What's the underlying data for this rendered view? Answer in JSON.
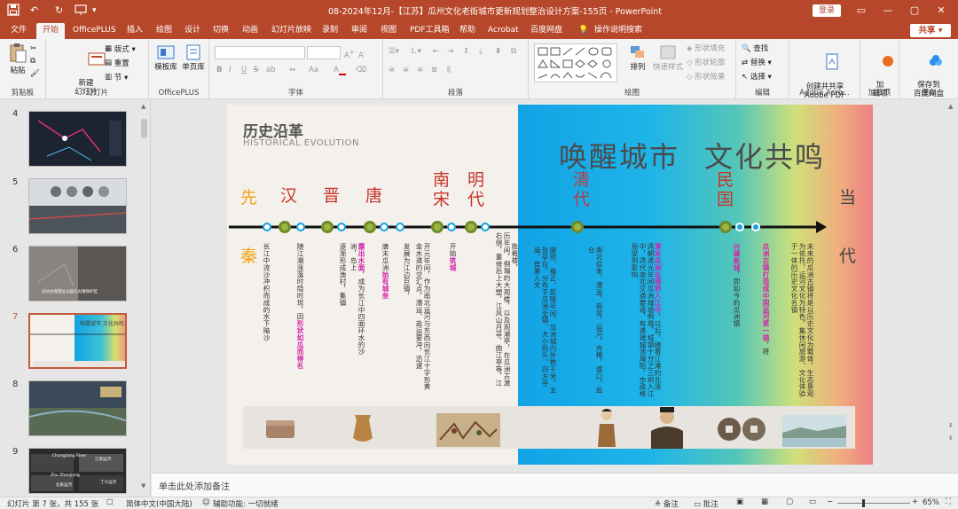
{
  "titlebar": {
    "document_title": "08-2024年12月-【江苏】瓜州文化老街城市更新规划整治设计方案-155页 - PowerPoint",
    "login": "登录",
    "save_icon": "save-icon",
    "undo_icon": "↶",
    "redo_icon": "↻",
    "color": "#b7472a"
  },
  "menu": {
    "tabs": [
      "文件",
      "开始",
      "OfficePLUS",
      "插入",
      "绘图",
      "设计",
      "切换",
      "动画",
      "幻灯片放映",
      "录制",
      "审阅",
      "视图",
      "PDF工具箱",
      "帮助",
      "Acrobat",
      "百度网盘"
    ],
    "active_tab": "开始",
    "tell_me": "操作说明搜索",
    "share": "共享"
  },
  "ribbon": {
    "clipboard": {
      "paste": "粘贴",
      "label": "剪贴板"
    },
    "slides": {
      "new_slide": "新建\n幻灯片",
      "layout": "版式",
      "reset": "重置",
      "section": "节",
      "label": "幻灯片"
    },
    "officeplus": {
      "templates": "模板库",
      "single": "单页库",
      "label": "OfficePLUS"
    },
    "font": {
      "label": "字体",
      "bold": "B",
      "italic": "I",
      "underline": "U",
      "strike": "S",
      "shadow": "ab",
      "font_name": "",
      "font_size": "",
      "grow": "A",
      "shrink": "A"
    },
    "paragraph": {
      "label": "段落"
    },
    "drawing": {
      "arrange": "排列",
      "quick_styles": "快速样式",
      "fill": "形状填充",
      "outline": "形状轮廓",
      "effects": "形状效果",
      "label": "绘图"
    },
    "editing": {
      "find": "查找",
      "replace": "替换",
      "select": "选择",
      "label": "编辑"
    },
    "adobe": {
      "create_share": "创建并共享\nAdobe PDF",
      "label": "Adobe Acro..."
    },
    "addins": {
      "addins": "加\n载项",
      "label": "加载项"
    },
    "save": {
      "save_baidu": "保存到\n百度网盘",
      "label": "保存"
    }
  },
  "slide_panel": {
    "numbers": [
      "4",
      "5",
      "6",
      "7",
      "8",
      "9"
    ],
    "selected": "7",
    "thumb5_title": "",
    "thumb6_caption": "瓜州古渡遗址公园与古镇保护区",
    "thumb7_text": "唤醒城市 文化共鸣",
    "thumb8_caption": "",
    "thumb9_texts": [
      "Changjiang River",
      "江南运河",
      "Zhu Zhenjiang",
      "北来运河",
      "丁大运河"
    ]
  },
  "slide": {
    "header_cn": "历史沿革",
    "header_en": "HISTORICAL EVOLUTION",
    "headline_left": "唤醒城市",
    "headline_right": "文化共鸣",
    "eras": {
      "xianqin": "先",
      "qin": "秦",
      "han": "汉",
      "jin": "晋",
      "tang": "唐",
      "nan": "南",
      "song": "宋",
      "ming": "明",
      "dai": "代",
      "qing": "清",
      "qdai": "代",
      "minguo1": "民",
      "minguo2": "国",
      "dang": "当",
      "ddai": "代"
    },
    "texts": [
      {
        "plain": "长江中流沙冲积而成的水下暗沙",
        "hl": ""
      },
      {
        "plain": "随江潮涨落时隐时现，因",
        "hl": "形状如瓜而得名"
      },
      {
        "plain": "逐渐形成渔村，集镇",
        "hl": ""
      },
      {
        "plain": "",
        "hl": "露出水面",
        "plain2": "，成为长江中四面环水的沙洲，岛上"
      },
      {
        "plain": "唐末瓜洲",
        "hl": "始有城垒"
      },
      {
        "plain": "发展为江边巨镇，",
        "plain2": ""
      },
      {
        "plain": "开元年间，作为南北运河与东西向长江十字形黄金水道的交汇点，漕运、盐运要冲，迅速"
      },
      {
        "plain": "开始",
        "hl": "筑城"
      },
      {
        "plain": "历年间，倒塌的大观楼，以及观潮亭，在瓜洲古渡右侧，重修后上大塑，江风山月亭，曲江亭等，江"
      },
      {
        "plain": "胜概楼，"
      },
      {
        "plain": "康熙、雍正、乾隆年间，瓜洲城内外数千米，五处亭台，分布于瓜洲全镇、大小码头、四方寺庙、官署人文"
      },
      {
        "plain": "南北往来，漕运，商贸，运河，舟楫，渡口，盐仓"
      },
      {
        "plain": "清朝道光年间瓜洲城墙倒塌，城镇十分之三坍入江中，清代南北交通要道，有道理城池塌陷，市政格局受到影响"
      },
      {
        "plain": "",
        "hl": "清末瓜洲全城坍入江中",
        "plain2": "，以后，随着江滩的北涨"
      },
      {
        "plain": "",
        "hl": "兴建新城",
        "plain2": "，即如今的瓜洲镇"
      },
      {
        "plain": "",
        "hl": "瓜洲古镇打造成",
        "plain2": "中国运河第一镇",
        "plain3": "，将"
      },
      {
        "plain": "未来的瓜洲古镇将是以历史文化为载体，生态景观为依托，运河文化为特色，集休闲旅游、文化体验于一体的历史文化名镇"
      }
    ],
    "artifacts": [
      "jade-artifact",
      "pottery-vessel",
      "battle-painting",
      "tang-lady-figure",
      "ming-scholar-portrait",
      "ancient-coins",
      "river-landscape-photo"
    ]
  },
  "notes": {
    "placeholder": "单击此处添加备注"
  },
  "status": {
    "slide_info": "幻灯片 第 7 张，共 155 张",
    "language": "简体中文(中国大陆)",
    "accessibility": "辅助功能: 一切就绪",
    "notes": "备注",
    "comments": "批注",
    "zoom": "65%"
  },
  "colors": {
    "accent": "#b7472a",
    "blue": "#12a3e6",
    "magenta": "#d424a8",
    "era_orange": "#f2a516",
    "era_red": "#c7352b"
  }
}
